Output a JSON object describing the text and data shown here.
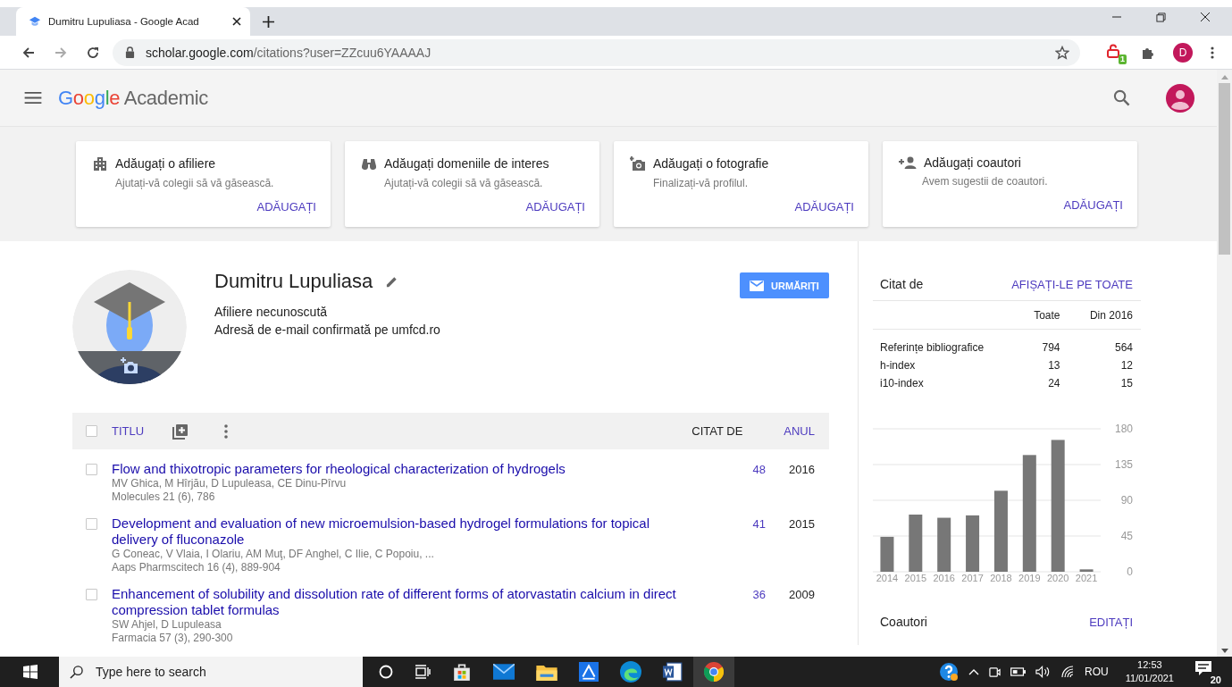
{
  "browser": {
    "tab_title": "Dumitru Lupuliasa - Google Acad",
    "url_host": "scholar.google.com",
    "url_path": "/citations?user=ZZcuu6YAAAAJ",
    "extension_badge": "1",
    "profile_initial": "D"
  },
  "header": {
    "logo_google": "Google",
    "logo_product": "Academic"
  },
  "cards": [
    {
      "kind": "building",
      "title": "Adăugați o afiliere",
      "subtitle": "Ajutați-vă colegii să vă găsească.",
      "action": "ADĂUGAȚI"
    },
    {
      "kind": "binoculars",
      "title": "Adăugați domeniile de interes",
      "subtitle": "Ajutați-vă colegii să vă găsească.",
      "action": "ADĂUGAȚI"
    },
    {
      "kind": "camera",
      "title": "Adăugați o fotografie",
      "subtitle": "Finalizați-vă profilul.",
      "action": "ADĂUGAȚI"
    },
    {
      "kind": "person",
      "title": "Adăugați coautori",
      "subtitle": "Avem sugestii de coautori.",
      "action": "ADĂUGAȚI"
    }
  ],
  "profile": {
    "name": "Dumitru Lupuliasa",
    "affiliation": "Afiliere necunoscută",
    "email": "Adresă de e-mail confirmată pe umfcd.ro",
    "follow": "URMĂRIȚI"
  },
  "articles_header": {
    "checked": false,
    "title": "TITLU",
    "cited": "CITAT DE",
    "year": "ANUL"
  },
  "articles": [
    {
      "checked": false,
      "title": "Flow and thixotropic parameters for rheological characterization of hydrogels",
      "authors": "MV Ghica, M Hîrjău, D Lupuleasa, CE Dinu-Pîrvu",
      "venue": "Molecules 21 (6), 786",
      "cited": "48",
      "year": "2016"
    },
    {
      "checked": false,
      "title": "Development and evaluation of new microemulsion-based hydrogel formulations for topical delivery of fluconazole",
      "authors": "G Coneac, V Vlaia, I Olariu, AM Muţ, DF Anghel, C Ilie, C Popoiu, ...",
      "venue": "Aaps Pharmscitech 16 (4), 889-904",
      "cited": "41",
      "year": "2015"
    },
    {
      "checked": false,
      "title": "Enhancement of solubility and dissolution rate of different forms of atorvastatin calcium in direct compression tablet formulas",
      "authors": "SW Ahjel, D Lupuleasa",
      "venue": "Farmacia 57 (3), 290-300",
      "cited": "36",
      "year": "2009"
    }
  ],
  "citations": {
    "heading": "Citat de",
    "link": "AFIȘAȚI-LE PE TOATE",
    "columns": [
      "Toate",
      "Din 2016"
    ],
    "rows": [
      {
        "label": "Referințe bibliografice",
        "all": "794",
        "since": "564"
      },
      {
        "label": "h-index",
        "all": "13",
        "since": "12"
      },
      {
        "label": "i10-index",
        "all": "24",
        "since": "15"
      }
    ]
  },
  "chart_data": {
    "type": "bar",
    "categories": [
      "2014",
      "2015",
      "2016",
      "2017",
      "2018",
      "2019",
      "2020",
      "2021"
    ],
    "series": [
      {
        "color": "#777777",
        "values": [
          44,
          72,
          68,
          71,
          102,
          147,
          166,
          3
        ]
      }
    ],
    "ylim": [
      0,
      180
    ],
    "grid": true,
    "yticks": [
      0,
      45,
      90,
      135,
      180
    ]
  },
  "coauthors": {
    "heading": "Coautori",
    "link": "EDITAȚI"
  },
  "taskbar": {
    "search_placeholder": "Type here to search",
    "language": "ROU",
    "time": "12:53",
    "date": "11/01/2021",
    "notifications": "20"
  }
}
